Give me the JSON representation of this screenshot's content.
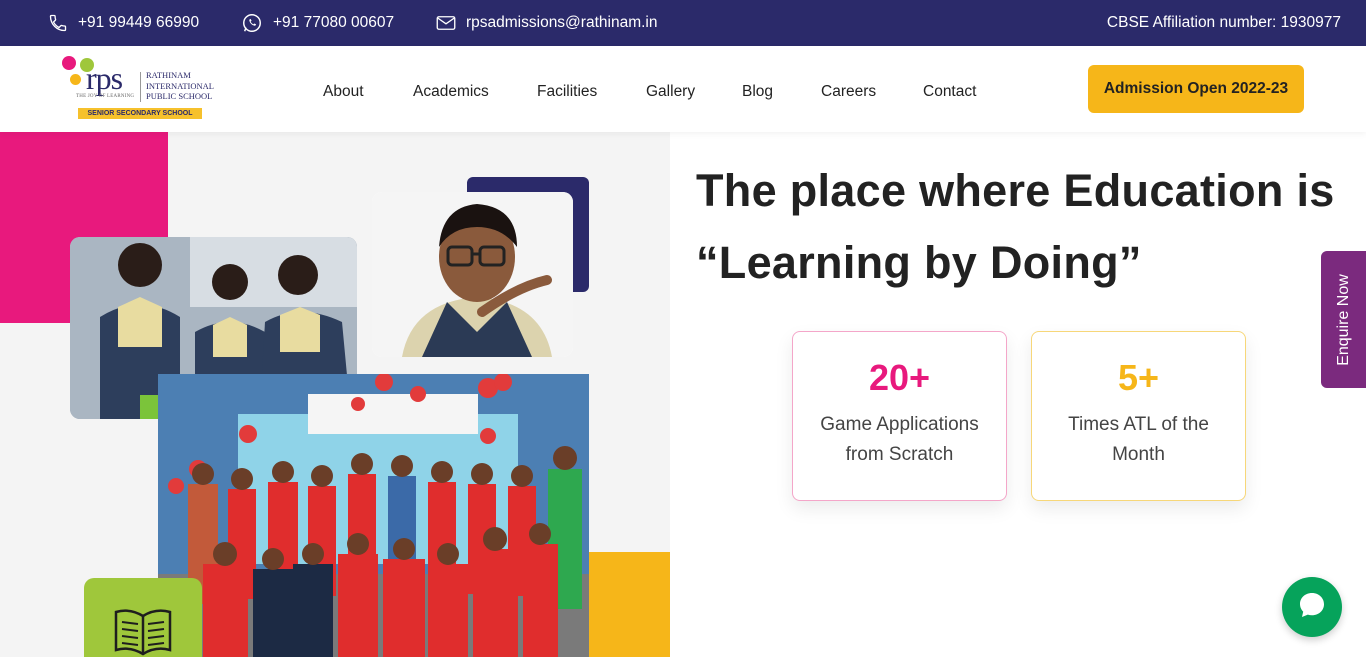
{
  "topbar": {
    "phone1": "+91 99449 66990",
    "phone2": "+91 77080 00607",
    "email": "rpsadmissions@rathinam.in",
    "affiliation": "CBSE Affiliation number: 1930977",
    "icons": [
      "phone-icon",
      "whatsapp-icon",
      "mail-icon"
    ],
    "background": "#2b2a6a"
  },
  "logo": {
    "mark": "rps",
    "tagline": "THE JOY OF LEARNING",
    "school_name_line1": "RATHINAM",
    "school_name_line2": "INTERNATIONAL",
    "school_name_line3": "PUBLIC SCHOOL",
    "badge": "SENIOR SECONDARY SCHOOL"
  },
  "nav": {
    "items": [
      {
        "label": "About"
      },
      {
        "label": "Academics"
      },
      {
        "label": "Facilities"
      },
      {
        "label": "Gallery"
      },
      {
        "label": "Blog"
      },
      {
        "label": "Careers"
      },
      {
        "label": "Contact"
      }
    ],
    "cta": "Admission Open 2022-23"
  },
  "hero": {
    "headline_line1": "The place where Education is",
    "headline_line2": "“Learning by Doing”",
    "stats": [
      {
        "value": "20+",
        "label": "Game Applications from Scratch",
        "color": "#e8197d",
        "border": "#f4a6c9"
      },
      {
        "value": "5+",
        "label": "Times ATL of the Month",
        "color": "#f6b619",
        "border": "#f7d779"
      }
    ]
  },
  "side": {
    "enquire": "Enquire Now"
  },
  "colors": {
    "pink": "#e8197d",
    "yellow": "#f6b619",
    "navy": "#2b2a6a",
    "green": "#9fc73b",
    "purple": "#7b2a7e",
    "chat": "#06a35b"
  }
}
